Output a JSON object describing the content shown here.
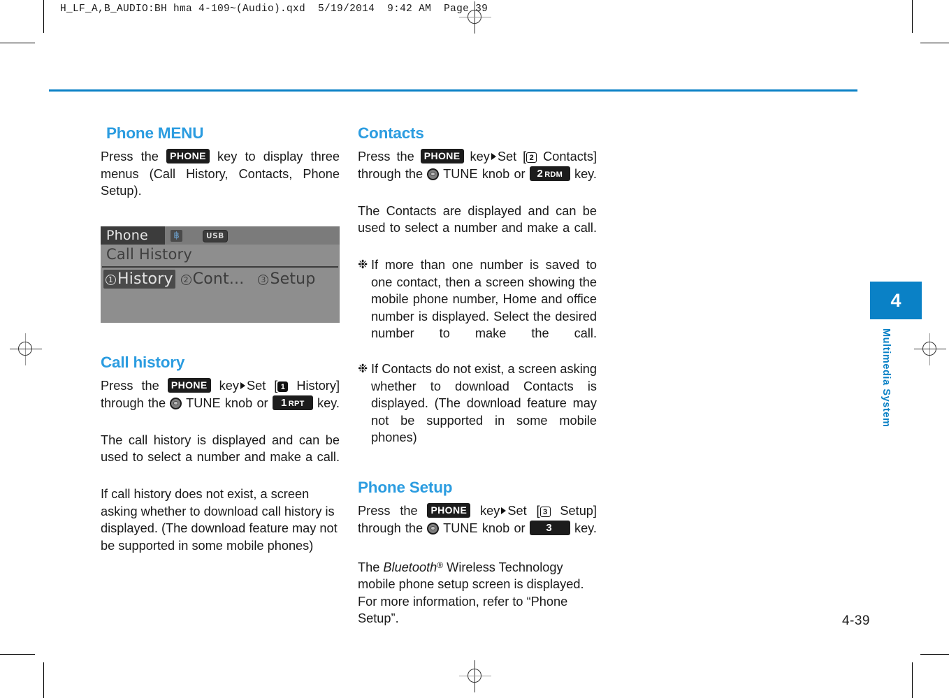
{
  "file_header": "H_LF_A,B_AUDIO:BH hma 4-109~(Audio).qxd  5/19/2014  9:42 AM  Page 39",
  "colors": {
    "accent_blue": "#0a81c6",
    "heading_blue": "#2b9ce0",
    "key_badge": "#1c1c1c",
    "screen_bg": "#8e8e8e"
  },
  "sidebar": {
    "chapter_number": "4",
    "chapter_label": "Multimedia System"
  },
  "footer": {
    "page_number": "4-39"
  },
  "left_column": {
    "phone_menu": {
      "heading": "Phone MENU",
      "intro_a": "Press the",
      "key_phone": "PHONE",
      "intro_b": "key to display three menus (Call History, Contacts, Phone Setup)."
    },
    "screen": {
      "title": "Phone",
      "bt_icon": "bluetooth-icon",
      "usb_label": "USB",
      "subtitle": "Call History",
      "menu": [
        {
          "number": "1",
          "label": "History",
          "selected": true
        },
        {
          "number": "2",
          "label": "Cont...",
          "selected": false
        },
        {
          "number": "3",
          "label": "Setup",
          "selected": false
        }
      ]
    },
    "call_history": {
      "heading": "Call history",
      "line1_a": "Press the",
      "key_phone": "PHONE",
      "line1_b": "key",
      "line1_c": "Set [",
      "circled": "1",
      "line1_d": "History] through the",
      "knob_label": "TUNE knob or",
      "key_num": "1",
      "key_num_sub": "RPT",
      "line1_e": "key.",
      "para2": "The call history is displayed and can be used to select a number and make a call.",
      "para3": "If call history does not exist, a screen asking whether to download call history is displayed. (The download feature may not be supported in some mobile phones)"
    }
  },
  "right_column": {
    "contacts": {
      "heading": "Contacts",
      "line1_a": "Press the",
      "key_phone": "PHONE",
      "line1_b": "key",
      "line1_c": "Set [",
      "circled": "2",
      "line1_d": "Contacts] through the",
      "knob_label": "TUNE knob or",
      "key_num": "2",
      "key_num_sub": "RDM",
      "line1_e": "key.",
      "para2": "The Contacts are displayed and can be used to select a number and make a call.",
      "bullet_mark": "❉",
      "bullet1": "If more than one number is saved to one contact, then a screen showing the mobile phone number, Home and office number is displayed. Select the desired number to make the call.",
      "bullet2": "If Contacts do not exist, a screen asking whether to download Contacts is displayed. (The download feature may not be supported in some mobile phones)"
    },
    "phone_setup": {
      "heading": "Phone Setup",
      "line1_a": "Press the",
      "key_phone": "PHONE",
      "line1_b": "key",
      "line1_c": "Set [",
      "circled": "3",
      "line1_d": "Setup] through the",
      "knob_label": "TUNE knob or",
      "key_num": "3",
      "key_num_sub": "",
      "line1_e": "key.",
      "para2_a": "The",
      "para2_italic": "Bluetooth",
      "para2_sup": "®",
      "para2_b": "Wireless Technology mobile phone setup screen is displayed. For more information, refer to “Phone Setup”."
    }
  }
}
